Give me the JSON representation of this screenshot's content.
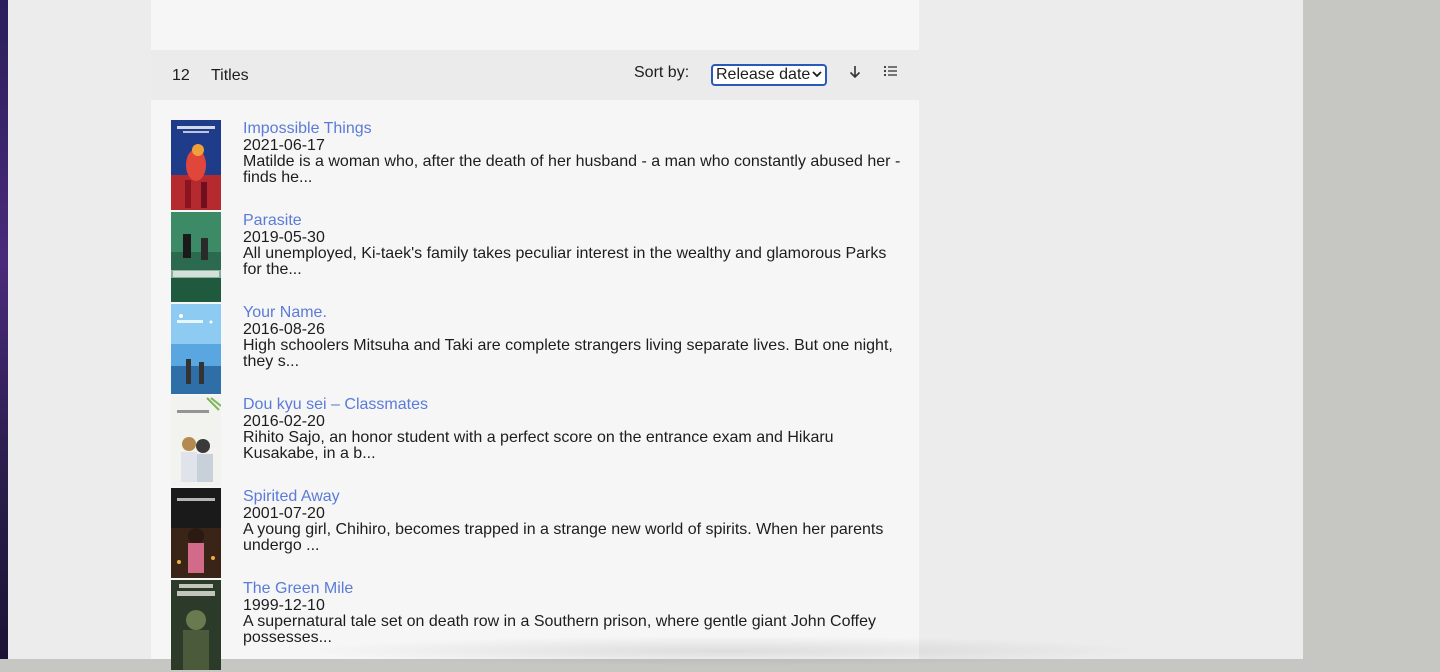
{
  "list": {
    "count": "12",
    "count_label": "Titles",
    "sort_label": "Sort by:",
    "sort_value": "Release date"
  },
  "movies": [
    {
      "title": "Impossible Things",
      "date": "2021-06-17",
      "desc": "Matilde is a woman who, after the death of her husband - a man who constantly abused her - finds he..."
    },
    {
      "title": "Parasite",
      "date": "2019-05-30",
      "desc": "All unemployed, Ki-taek's family takes peculiar interest in the wealthy and glamorous Parks for the..."
    },
    {
      "title": "Your Name.",
      "date": "2016-08-26",
      "desc": "High schoolers Mitsuha and Taki are complete strangers living separate lives. But one night, they s..."
    },
    {
      "title": "Dou kyu sei – Classmates",
      "date": "2016-02-20",
      "desc": "Rihito Sajo, an honor student with a perfect score on the entrance exam and Hikaru Kusakabe, in a b..."
    },
    {
      "title": "Spirited Away",
      "date": "2001-07-20",
      "desc": "A young girl, Chihiro, becomes trapped in a strange new world of spirits. When her parents undergo ..."
    },
    {
      "title": "The Green Mile",
      "date": "1999-12-10",
      "desc": "A supernatural tale set on death row in a Southern prison, where gentle giant John Coffey possesses..."
    }
  ],
  "colors": {
    "link": "#5a7bd8",
    "select_border": "#2a5ab8"
  },
  "icons": {
    "sort_direction": "arrow-down-icon",
    "view": "list-view-icon"
  }
}
